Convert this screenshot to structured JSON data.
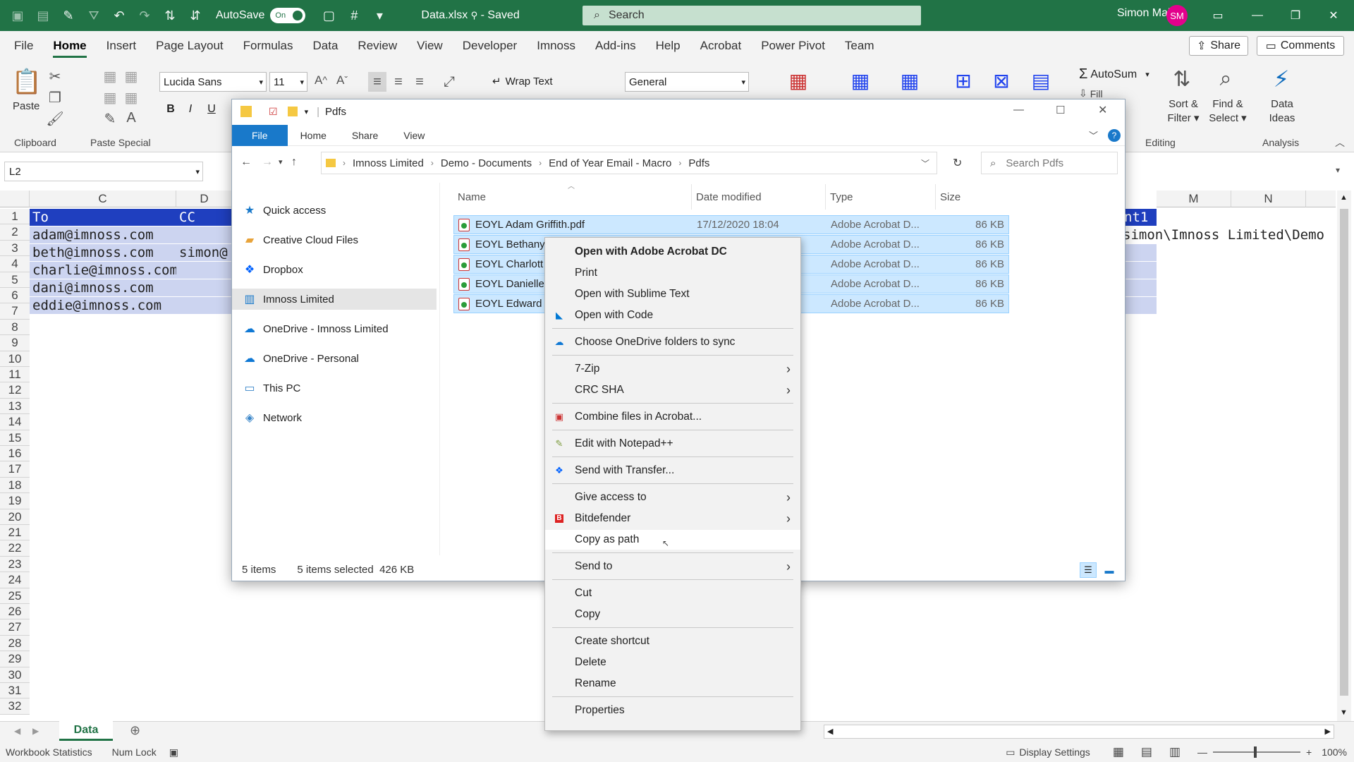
{
  "titlebar": {
    "autosave_label": "AutoSave",
    "autosave_state": "On",
    "doc_name": "Data.xlsx",
    "saved_state": "Saved",
    "search_placeholder": "Search",
    "user_name": "Simon Maller",
    "user_initials": "SM"
  },
  "ribbon_tabs": [
    "File",
    "Home",
    "Insert",
    "Page Layout",
    "Formulas",
    "Data",
    "Review",
    "View",
    "Developer",
    "Imnoss",
    "Add-ins",
    "Help",
    "Acrobat",
    "Power Pivot",
    "Team"
  ],
  "ribbon_right": {
    "share_label": "Share",
    "comments_label": "Comments"
  },
  "ribbon": {
    "paste_label": "Paste",
    "clipboard_label": "Clipboard",
    "paste_special_label": "Paste Special",
    "font_name": "Lucida Sans",
    "font_size": "11",
    "wrap_text_label": "Wrap Text",
    "number_format": "General",
    "autosum_label": "AutoSum",
    "fill_label": "Fill",
    "sort_filter_label": "Sort &",
    "sort_filter_label2": "Filter",
    "find_select_label": "Find &",
    "find_select_label2": "Select",
    "editing_label": "Editing",
    "data_ideas_label": "Data",
    "data_ideas_label2": "Ideas",
    "analysis_label": "Analysis",
    "bold": "B",
    "italic": "I",
    "underline": "U"
  },
  "formula_bar": {
    "name_box": "L2"
  },
  "sheet": {
    "columns_left": [
      "C",
      "D"
    ],
    "columns_right": [
      "M",
      "N"
    ],
    "rows": [
      "1",
      "2",
      "3",
      "4",
      "5",
      "6",
      "7",
      "8",
      "9",
      "10",
      "11",
      "12",
      "13",
      "14",
      "15",
      "16",
      "17",
      "18",
      "19",
      "20",
      "21",
      "22",
      "23",
      "24",
      "25",
      "26",
      "27",
      "28",
      "29",
      "30",
      "31",
      "32"
    ],
    "header_to": "To",
    "header_cc": "CC",
    "header_right": "nt1",
    "emails": [
      "adam@imnoss.com",
      "beth@imnoss.com",
      "charlie@imnoss.com",
      "dani@imnoss.com",
      "eddie@imnoss.com"
    ],
    "cc_row3": "simon@",
    "path_row2": "simon\\Imnoss Limited\\Demo -",
    "sheet_tab": "Data"
  },
  "statusbar": {
    "workbook_stats": "Workbook Statistics",
    "num_lock": "Num Lock",
    "display_settings": "Display Settings",
    "zoom": "100%"
  },
  "explorer": {
    "title": "Pdfs",
    "tabs": [
      "File",
      "Home",
      "Share",
      "View"
    ],
    "breadcrumb": [
      "Imnoss Limited",
      "Demo - Documents",
      "End of Year Email - Macro",
      "Pdfs"
    ],
    "search_placeholder": "Search Pdfs",
    "nav": [
      {
        "label": "Quick access",
        "icon": "star-icon"
      },
      {
        "label": "Creative Cloud Files",
        "icon": "creative-cloud-icon"
      },
      {
        "label": "Dropbox",
        "icon": "dropbox-icon"
      },
      {
        "label": "Imnoss Limited",
        "icon": "building-icon"
      },
      {
        "label": "OneDrive - Imnoss Limited",
        "icon": "onedrive-icon"
      },
      {
        "label": "OneDrive - Personal",
        "icon": "onedrive-icon"
      },
      {
        "label": "This PC",
        "icon": "computer-icon"
      },
      {
        "label": "Network",
        "icon": "network-icon"
      }
    ],
    "columns": [
      "Name",
      "Date modified",
      "Type",
      "Size"
    ],
    "files": [
      {
        "name": "EOYL Adam Griffith.pdf",
        "date": "17/12/2020 18:04",
        "type": "Adobe Acrobat D...",
        "size": "86 KB"
      },
      {
        "name": "EOYL Bethany",
        "date": "",
        "type": "Adobe Acrobat D...",
        "size": "86 KB"
      },
      {
        "name": "EOYL Charlott",
        "date": "",
        "type": "Adobe Acrobat D...",
        "size": "86 KB"
      },
      {
        "name": "EOYL Danielle",
        "date": "",
        "type": "Adobe Acrobat D...",
        "size": "86 KB"
      },
      {
        "name": "EOYL Edward",
        "date": "",
        "type": "Adobe Acrobat D...",
        "size": "86 KB"
      }
    ],
    "status_items": "5 items",
    "status_selected": "5 items selected",
    "status_size": "426 KB"
  },
  "context_menu": {
    "items": [
      {
        "label": "Open with Adobe Acrobat DC",
        "bold": true
      },
      {
        "label": "Print"
      },
      {
        "label": "Open with Sublime Text"
      },
      {
        "label": "Open with Code"
      },
      {
        "label": "Choose OneDrive folders to sync"
      },
      {
        "label": "7-Zip"
      },
      {
        "label": "CRC SHA"
      },
      {
        "label": "Combine files in Acrobat..."
      },
      {
        "label": "Edit with Notepad++"
      },
      {
        "label": "Send with Transfer..."
      },
      {
        "label": "Give access to"
      },
      {
        "label": "Bitdefender"
      },
      {
        "label": "Copy as path"
      },
      {
        "label": "Send to"
      },
      {
        "label": "Cut"
      },
      {
        "label": "Copy"
      },
      {
        "label": "Create shortcut"
      },
      {
        "label": "Delete"
      },
      {
        "label": "Rename"
      },
      {
        "label": "Properties"
      }
    ]
  },
  "colors": {
    "excel_green": "#217346",
    "header_blue": "#1f3fbf",
    "selection_blue": "#cce8ff",
    "file_tab_blue": "#1979ca"
  }
}
